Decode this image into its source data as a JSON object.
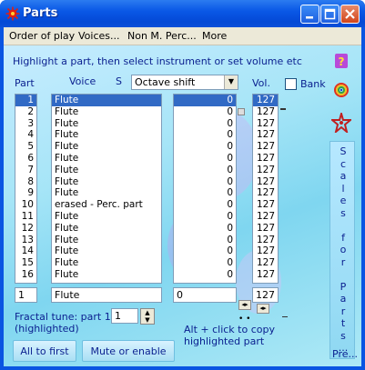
{
  "window": {
    "title": "Parts"
  },
  "menu": [
    "Order of play",
    "Voices...",
    "Non M. Perc...",
    "More"
  ],
  "hint": "Highlight a part, then select instrument or set volume etc",
  "headers": {
    "part": "Part",
    "voice": "Voice",
    "s": "S",
    "vol": "Vol.",
    "bank": "Bank"
  },
  "octave_select": {
    "value": "Octave shift"
  },
  "rows": [
    {
      "part": "1",
      "voice": "Flute",
      "shift": "0",
      "vol": "127"
    },
    {
      "part": "2",
      "voice": "Flute",
      "shift": "0",
      "vol": "127"
    },
    {
      "part": "3",
      "voice": "Flute",
      "shift": "0",
      "vol": "127"
    },
    {
      "part": "4",
      "voice": "Flute",
      "shift": "0",
      "vol": "127"
    },
    {
      "part": "5",
      "voice": "Flute",
      "shift": "0",
      "vol": "127"
    },
    {
      "part": "6",
      "voice": "Flute",
      "shift": "0",
      "vol": "127"
    },
    {
      "part": "7",
      "voice": "Flute",
      "shift": "0",
      "vol": "127"
    },
    {
      "part": "8",
      "voice": "Flute",
      "shift": "0",
      "vol": "127"
    },
    {
      "part": "9",
      "voice": "Flute",
      "shift": "0",
      "vol": "127"
    },
    {
      "part": "10",
      "voice": "erased - Perc. part",
      "shift": "0",
      "vol": "127"
    },
    {
      "part": "11",
      "voice": "Flute",
      "shift": "0",
      "vol": "127"
    },
    {
      "part": "12",
      "voice": "Flute",
      "shift": "0",
      "vol": "127"
    },
    {
      "part": "13",
      "voice": "Flute",
      "shift": "0",
      "vol": "127"
    },
    {
      "part": "14",
      "voice": "Flute",
      "shift": "0",
      "vol": "127"
    },
    {
      "part": "15",
      "voice": "Flute",
      "shift": "0",
      "vol": "127"
    },
    {
      "part": "16",
      "voice": "Flute",
      "shift": "0",
      "vol": "127"
    }
  ],
  "edit": {
    "part": "1",
    "voice": "Flute",
    "shift": "0",
    "vol": "127"
  },
  "fractal": {
    "label_line1": "Fractal tune: part 1",
    "label_line2": "(highlighted)",
    "value": "1"
  },
  "alt_hint_line1": "Alt + click to copy",
  "alt_hint_line2": "highlighted part",
  "buttons": {
    "all_to_first": "All to first",
    "mute": "Mute or enable",
    "pre": "Pre..."
  },
  "scales_text": [
    "S",
    "c",
    "a",
    "l",
    "e",
    "s",
    "",
    "f",
    "o",
    "r",
    "",
    "P",
    "a",
    "r",
    "t",
    "s",
    "..."
  ],
  "colors": {
    "title_blue": "#0a55e2",
    "selection": "#316ac5",
    "text_blue": "#0a1f8f"
  }
}
